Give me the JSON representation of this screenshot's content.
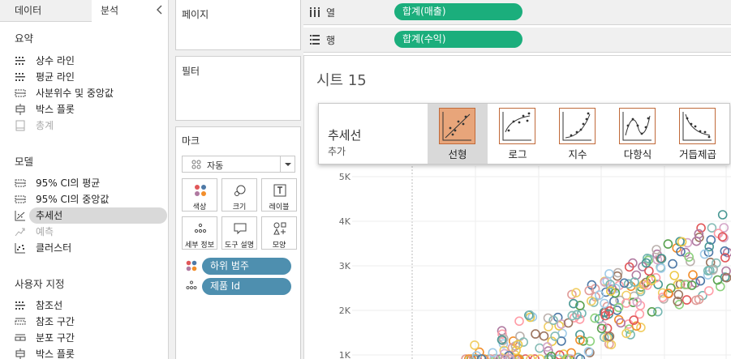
{
  "left_pane": {
    "tabs": [
      {
        "label": "데이터"
      },
      {
        "label": "분석"
      }
    ],
    "sections": [
      {
        "title": "요약",
        "items": [
          {
            "label": "상수 라인",
            "icon": "constant-line-icon"
          },
          {
            "label": "평균 라인",
            "icon": "average-line-icon"
          },
          {
            "label": "사분위수 및 중앙값",
            "icon": "quartile-icon"
          },
          {
            "label": "박스 플롯",
            "icon": "box-plot-icon"
          },
          {
            "label": "총계",
            "icon": "totals-icon",
            "disabled": true
          }
        ]
      },
      {
        "title": "모델",
        "items": [
          {
            "label": "95% CI의 평균",
            "icon": "ci-mean-icon"
          },
          {
            "label": "95% CI의 중앙값",
            "icon": "ci-median-icon"
          },
          {
            "label": "추세선",
            "icon": "trend-line-icon",
            "selected": true
          },
          {
            "label": "예측",
            "icon": "forecast-icon",
            "disabled": true
          },
          {
            "label": "클러스터",
            "icon": "cluster-icon"
          }
        ]
      },
      {
        "title": "사용자 지정",
        "items": [
          {
            "label": "참조선",
            "icon": "reference-line-icon"
          },
          {
            "label": "참조 구간",
            "icon": "reference-band-icon"
          },
          {
            "label": "분포 구간",
            "icon": "distribution-band-icon"
          },
          {
            "label": "박스 플롯",
            "icon": "box-plot-icon"
          }
        ]
      }
    ]
  },
  "shelves": {
    "pages": "페이지",
    "filters": "필터",
    "marks": {
      "title": "마크",
      "type": "자동",
      "buttons": [
        "색상",
        "크기",
        "레이블",
        "세부 정보",
        "도구 설명",
        "모양"
      ],
      "fields": [
        {
          "label": "하위 범주",
          "icon": "color-dots-icon"
        },
        {
          "label": "제품 Id",
          "icon": "detail-dots-icon"
        }
      ]
    }
  },
  "columns": {
    "label": "열",
    "pill": "합계(매출)"
  },
  "rows": {
    "label": "행",
    "pill": "합계(수익)"
  },
  "sheet": {
    "title": "시트 15"
  },
  "trend_popup": {
    "title": "추세선",
    "subtitle": "추가",
    "options": [
      "선형",
      "로그",
      "지수",
      "다항식",
      "거듭제곱"
    ],
    "active": "선형"
  },
  "colors": {
    "accent_green": "#1bae7c",
    "pill_blue": "#4e8faf",
    "trend_orange": "#e8a57a"
  },
  "chart_data": {
    "type": "scatter",
    "y_ticks": [
      "5K",
      "4K",
      "3K",
      "2K",
      "1K"
    ],
    "series_colors": [
      "#4e79a7",
      "#f28e2b",
      "#e15759",
      "#76b7b2",
      "#59a14f",
      "#edc948",
      "#b07aa1",
      "#ff9da7",
      "#9c755f",
      "#bab0ac",
      "#a0cbe8",
      "#8cd17d",
      "#f1ce63",
      "#d4a6c8",
      "#499894",
      "#86bcb6",
      "#e19d9a"
    ]
  }
}
